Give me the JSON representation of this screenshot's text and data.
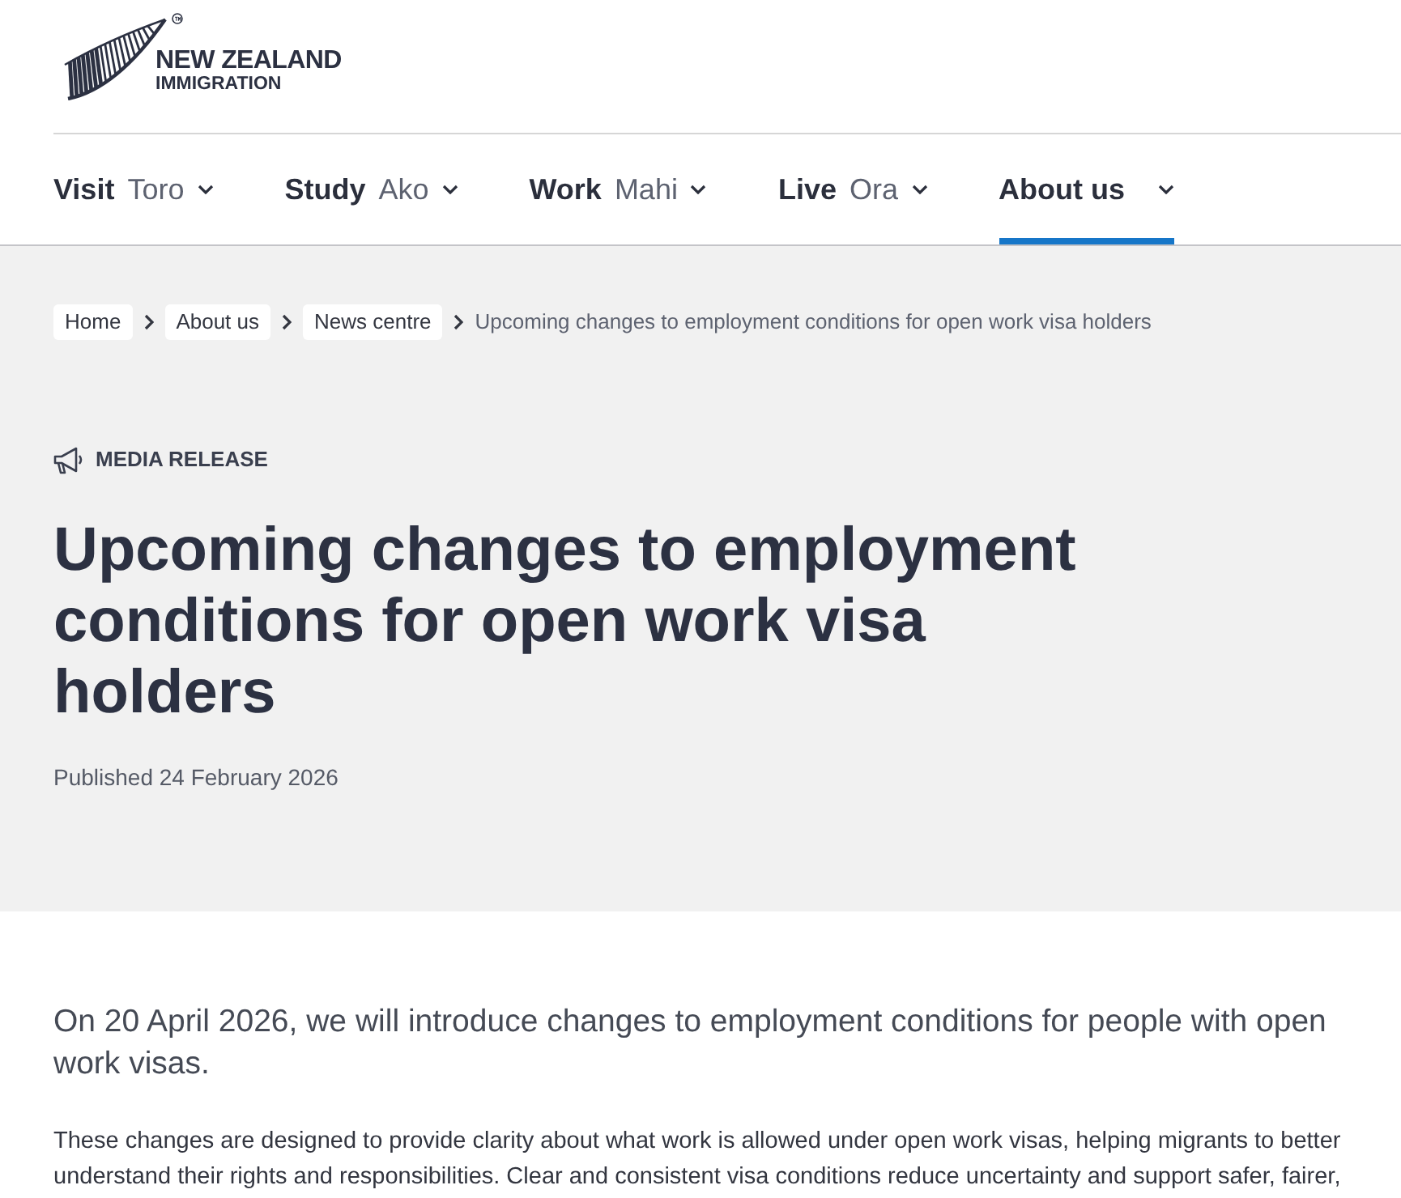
{
  "logo": {
    "title": "NEW ZEALAND",
    "subtitle": "IMMIGRATION"
  },
  "nav": [
    {
      "label": "Visit",
      "sublabel": "Toro",
      "selected": false
    },
    {
      "label": "Study",
      "sublabel": "Ako",
      "selected": false
    },
    {
      "label": "Work",
      "sublabel": "Mahi",
      "selected": false
    },
    {
      "label": "Live",
      "sublabel": "Ora",
      "selected": false
    },
    {
      "label": "About us",
      "selected": true
    }
  ],
  "breadcrumb": {
    "links": [
      "Home",
      "About us",
      "News centre"
    ],
    "current": "Upcoming changes to employment conditions for open work visa holders"
  },
  "article": {
    "category": "MEDIA RELEASE",
    "title": "Upcoming changes to employment conditions for open work visa holders",
    "published": "Published 24 February 2026",
    "lead": "On 20 April 2026, we will introduce changes to employment conditions for people with open work visas.",
    "body_lines": [
      "These changes are designed to provide clarity about what work is allowed under open work visas, helping migrants to better",
      "understand their rights and responsibilities. Clear and consistent visa conditions reduce uncertainty and support safer, fairer,"
    ]
  }
}
